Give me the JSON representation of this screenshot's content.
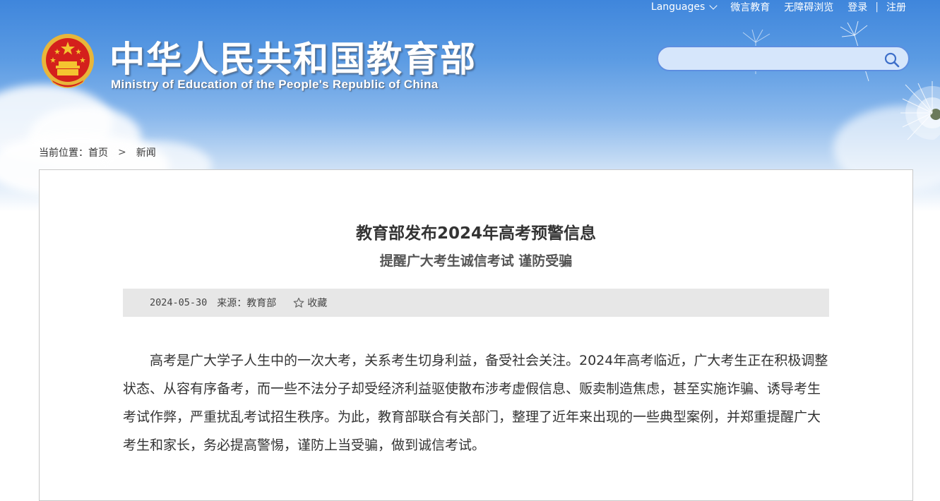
{
  "topbar": {
    "languages": "Languages",
    "weiyan": "微言教育",
    "accessibility": "无障碍浏览",
    "login": "登录",
    "separator": "|",
    "register": "注册"
  },
  "header": {
    "title_cn": "中华人民共和国教育部",
    "title_en": "Ministry of Education of the People's Republic of China"
  },
  "search": {
    "placeholder": ""
  },
  "breadcrumb": {
    "prefix": "当前位置：",
    "home": "首页",
    "arrow": ">",
    "current": "新闻"
  },
  "article": {
    "title": "教育部发布2024年高考预警信息",
    "subtitle": "提醒广大考生诚信考试 谨防受骗",
    "date": "2024-05-30",
    "source": "来源：教育部",
    "favorite": "收藏",
    "paragraph": "高考是广大学子人生中的一次大考，关系考生切身利益，备受社会关注。2024年高考临近，广大考生正在积极调整状态、从容有序备考，而一些不法分子却受经济利益驱使散布涉考虚假信息、贩卖制造焦虑，甚至实施诈骗、诱导考生考试作弊，严重扰乱考试招生秩序。为此，教育部联合有关部门，整理了近年来出现的一些典型案例，并郑重提醒广大考生和家长，务必提高警惕，谨防上当受骗，做到诚信考试。"
  },
  "colors": {
    "sky_top": "#3f86dc",
    "emblem_red": "#d4201c",
    "emblem_gold": "#f4c430",
    "meta_bg": "#e7e7e7"
  }
}
